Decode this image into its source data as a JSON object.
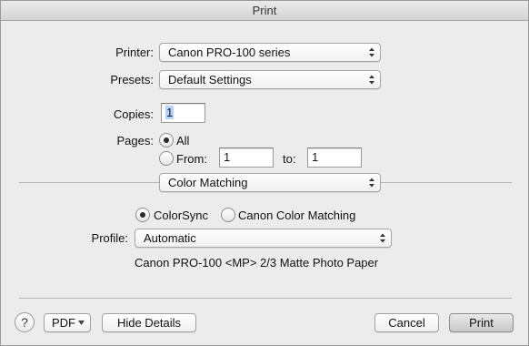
{
  "window": {
    "title": "Print"
  },
  "printer": {
    "label": "Printer:",
    "value": "Canon PRO-100 series"
  },
  "presets": {
    "label": "Presets:",
    "value": "Default Settings"
  },
  "copies": {
    "label": "Copies:",
    "value": "1"
  },
  "pages": {
    "label": "Pages:",
    "all_label": "All",
    "from_label": "From:",
    "from_value": "1",
    "to_label": "to:",
    "to_value": "1",
    "selected": "All"
  },
  "section": {
    "value": "Color Matching"
  },
  "color_matching": {
    "options": [
      "ColorSync",
      "Canon Color Matching"
    ],
    "selected": "ColorSync",
    "profile_label": "Profile:",
    "profile_value": "Automatic",
    "profile_description": "Canon PRO-100 <MP> 2/3 Matte Photo Paper"
  },
  "footer": {
    "help_glyph": "?",
    "pdf_label": "PDF",
    "hide_details_label": "Hide Details",
    "cancel_label": "Cancel",
    "print_label": "Print"
  }
}
